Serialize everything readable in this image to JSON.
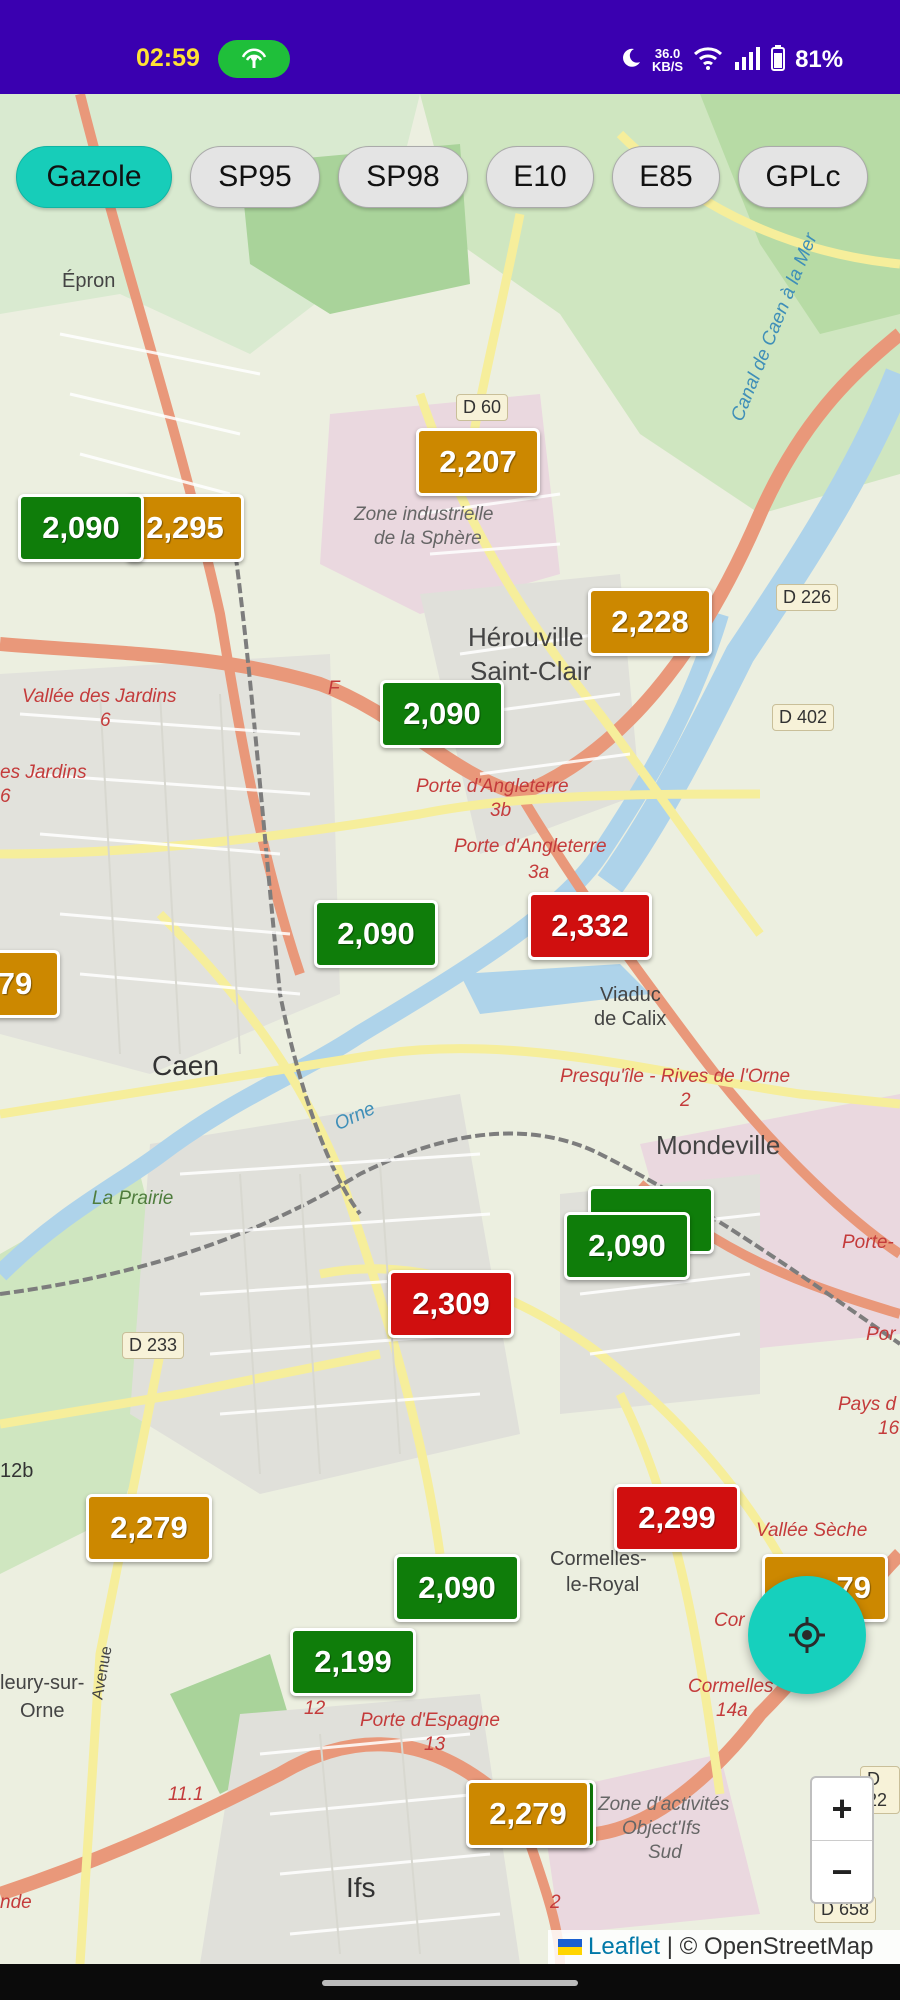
{
  "status_bar": {
    "time": "02:59",
    "speed_top": "36.0",
    "speed_bottom": "KB/S",
    "battery": "81%",
    "icons": [
      "hotspot-icon",
      "moon-icon",
      "wifi-icon",
      "signal-icon",
      "battery-icon"
    ]
  },
  "fuel_tabs": [
    {
      "label": "Gazole",
      "active": true
    },
    {
      "label": "SP95",
      "active": false
    },
    {
      "label": "SP98",
      "active": false
    },
    {
      "label": "E10",
      "active": false
    },
    {
      "label": "E85",
      "active": false
    },
    {
      "label": "GPLc",
      "active": false
    }
  ],
  "markers": [
    {
      "price": "2,207",
      "level": "orange"
    },
    {
      "price": "2,295",
      "level": "orange"
    },
    {
      "price": "2,090",
      "level": "green"
    },
    {
      "price": "2,228",
      "level": "orange"
    },
    {
      "price": "2,090",
      "level": "green"
    },
    {
      "price": "2,090",
      "level": "green"
    },
    {
      "price": "2,332",
      "level": "red"
    },
    {
      "price": "79",
      "level": "orange"
    },
    {
      "price": "2,090",
      "level": "green"
    },
    {
      "price": "2,309",
      "level": "red"
    },
    {
      "price": "2,279",
      "level": "orange"
    },
    {
      "price": "2,299",
      "level": "red"
    },
    {
      "price": "79",
      "level": "orange"
    },
    {
      "price": "2,090",
      "level": "green"
    },
    {
      "price": "2,199",
      "level": "green"
    },
    {
      "price": "2,279",
      "level": "orange"
    }
  ],
  "map_labels": {
    "epron": "Épron",
    "caen": "Caen",
    "herouville": "Hérouville",
    "saint_clair": "Saint-Clair",
    "mondeville": "Mondeville",
    "cormelles": "Cormelles-",
    "le_royal": "le-Royal",
    "ifs": "Ifs",
    "fleury": "leury-sur-",
    "orne": "Orne",
    "la_prairie": "La Prairie",
    "zone_sphere_1": "Zone industrielle",
    "zone_sphere_2": "de la Sphère",
    "zone_ifs_1": "Zone d'activités",
    "zone_ifs_2": "Object'Ifs",
    "zone_ifs_3": "Sud",
    "viaduc_1": "Viaduc",
    "viaduc_2": "de Calix",
    "vallee_jardins": "Vallée des Jardins",
    "vallee_jardins_num": "6",
    "es_jardins": "es Jardins",
    "es_jardins_num": "6",
    "porte_angleterre_3b": "Porte d'Angleterre",
    "num_3b": "3b",
    "porte_angleterre_3a": "Porte d'Angleterre",
    "num_3a": "3a",
    "presqu_ile": "Presqu'île - Rives de l'Orne",
    "presqu_ile_num": "2",
    "porte_espagne": "Porte d'Espagne",
    "porte_espagne_num": "13",
    "cormelles_exit": "Cormelles",
    "cormelles_exit_num": "14a",
    "vallee_seche": "Vallée Sèche",
    "pays_d": "Pays d",
    "pays_num": "16",
    "porte_right": "Porte-",
    "por_right": "Por",
    "cor_right": "Cor",
    "f_label": "F",
    "num_12b": "12b",
    "num_12": "12",
    "num_11": "11.1",
    "num_2": "2",
    "nde": "nde",
    "orne_river": "Orne",
    "canal": "Canal de Caen à la Mer",
    "d_60": "D 60",
    "d_226": "D 226",
    "d_402": "D 402",
    "d_233": "D 233",
    "d_658": "D 658",
    "d_22": "D 22",
    "avenue": "Avenue"
  },
  "zoom": {
    "in": "+",
    "out": "−"
  },
  "attribution": {
    "leaflet": "Leaflet",
    "separator": " | © OpenStreetMap"
  }
}
